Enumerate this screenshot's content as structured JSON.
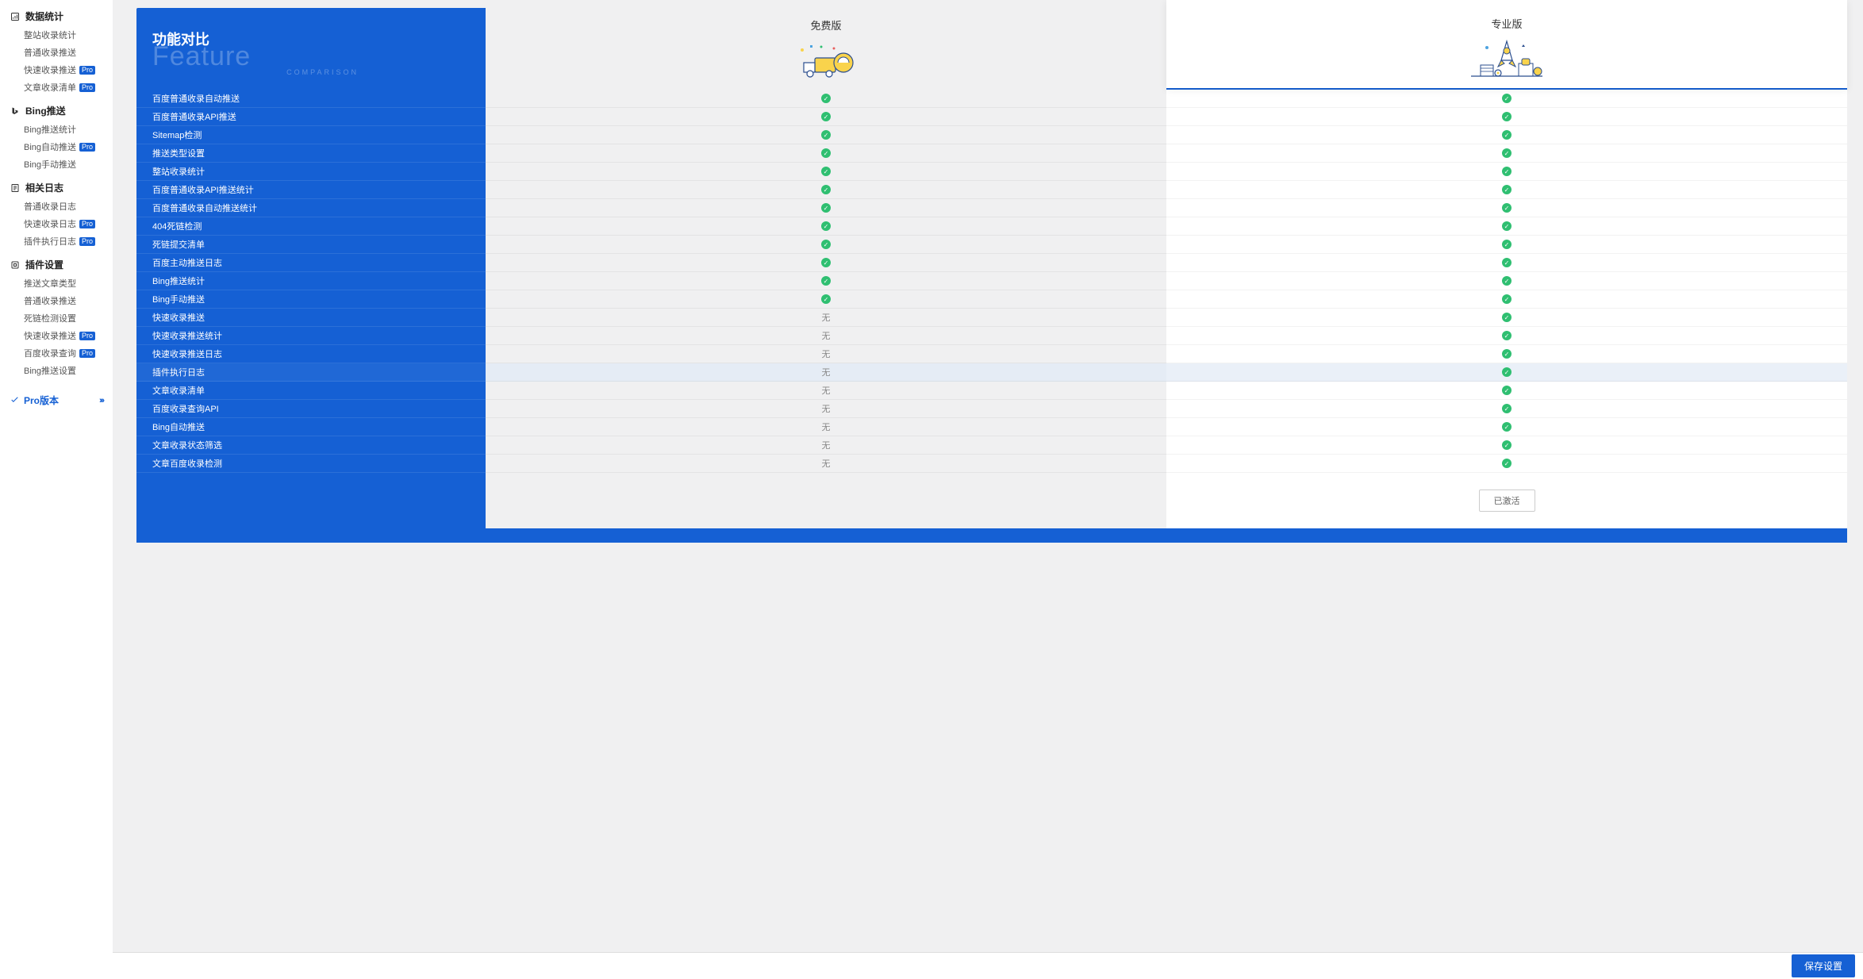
{
  "sidebar": [
    {
      "head": "数据统计",
      "icon": "stats",
      "items": [
        {
          "label": "整站收录统计"
        },
        {
          "label": "普通收录推送"
        },
        {
          "label": "快速收录推送",
          "pro": true
        },
        {
          "label": "文章收录清单",
          "pro": true
        }
      ]
    },
    {
      "head": "Bing推送",
      "icon": "bing",
      "items": [
        {
          "label": "Bing推送统计"
        },
        {
          "label": "Bing自动推送",
          "pro": true
        },
        {
          "label": "Bing手动推送"
        }
      ]
    },
    {
      "head": "相关日志",
      "icon": "log",
      "items": [
        {
          "label": "普通收录日志"
        },
        {
          "label": "快速收录日志",
          "pro": true
        },
        {
          "label": "插件执行日志",
          "pro": true
        }
      ]
    },
    {
      "head": "插件设置",
      "icon": "plugin",
      "items": [
        {
          "label": "推送文章类型"
        },
        {
          "label": "普通收录推送"
        },
        {
          "label": "死链检测设置"
        },
        {
          "label": "快速收录推送",
          "pro": true
        },
        {
          "label": "百度收录查询",
          "pro": true
        },
        {
          "label": "Bing推送设置"
        }
      ]
    }
  ],
  "pro_link": "Pro版本",
  "pro_badge": "Pro",
  "compare": {
    "title_cn": "功能对比",
    "title_en": "Feature",
    "title_sub": "COMPARISON",
    "free_title": "免费版",
    "pro_title": "专业版",
    "none_text": "无",
    "activated": "已激活",
    "rows": [
      {
        "label": "百度普通收录自动推送",
        "free": "check",
        "pro": "check"
      },
      {
        "label": "百度普通收录API推送",
        "free": "check",
        "pro": "check"
      },
      {
        "label": "Sitemap检测",
        "free": "check",
        "pro": "check"
      },
      {
        "label": "推送类型设置",
        "free": "check",
        "pro": "check"
      },
      {
        "label": "整站收录统计",
        "free": "check",
        "pro": "check"
      },
      {
        "label": "百度普通收录API推送统计",
        "free": "check",
        "pro": "check"
      },
      {
        "label": "百度普通收录自动推送统计",
        "free": "check",
        "pro": "check"
      },
      {
        "label": "404死链检测",
        "free": "check",
        "pro": "check"
      },
      {
        "label": "死链提交清单",
        "free": "check",
        "pro": "check"
      },
      {
        "label": "百度主动推送日志",
        "free": "check",
        "pro": "check"
      },
      {
        "label": "Bing推送统计",
        "free": "check",
        "pro": "check"
      },
      {
        "label": "Bing手动推送",
        "free": "check",
        "pro": "check"
      },
      {
        "label": "快速收录推送",
        "free": "none",
        "pro": "check"
      },
      {
        "label": "快速收录推送统计",
        "free": "none",
        "pro": "check"
      },
      {
        "label": "快速收录推送日志",
        "free": "none",
        "pro": "check"
      },
      {
        "label": "插件执行日志",
        "free": "none",
        "pro": "check",
        "hl": true
      },
      {
        "label": "文章收录清单",
        "free": "none",
        "pro": "check"
      },
      {
        "label": "百度收录查询API",
        "free": "none",
        "pro": "check"
      },
      {
        "label": "Bing自动推送",
        "free": "none",
        "pro": "check"
      },
      {
        "label": "文章收录状态筛选",
        "free": "none",
        "pro": "check"
      },
      {
        "label": "文章百度收录检测",
        "free": "none",
        "pro": "check"
      }
    ]
  },
  "save_label": "保存设置"
}
